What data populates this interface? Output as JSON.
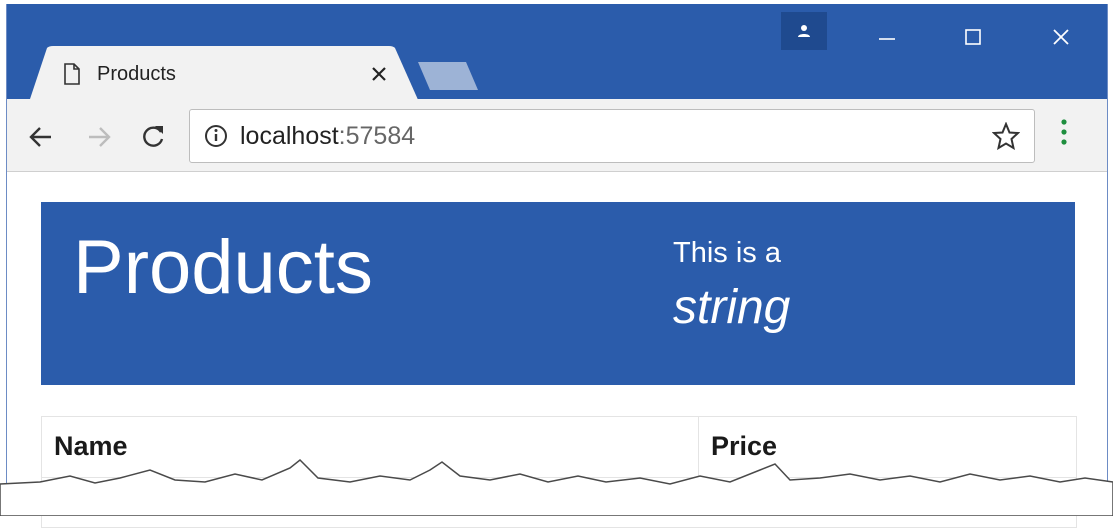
{
  "browser": {
    "tab": {
      "title": "Products"
    },
    "address": {
      "host": "localhost",
      "port": ":57584"
    }
  },
  "page": {
    "jumbotron": {
      "title": "Products",
      "subtitle": "This is a",
      "emphasis": "string"
    },
    "table": {
      "headers": [
        "Name",
        "Price"
      ]
    }
  },
  "colors": {
    "titlebar": "#2b5cab",
    "jumbotron": "#2b5cab",
    "toolbar": "#f2f2f2",
    "menu_dots": "#1e8e3e"
  },
  "icons": [
    "profile-icon",
    "minimize-icon",
    "maximize-icon",
    "close-icon",
    "page-icon",
    "tab-close-icon",
    "new-tab-icon",
    "back-arrow-icon",
    "forward-arrow-icon",
    "reload-icon",
    "info-icon",
    "star-icon",
    "menu-dots-icon"
  ]
}
